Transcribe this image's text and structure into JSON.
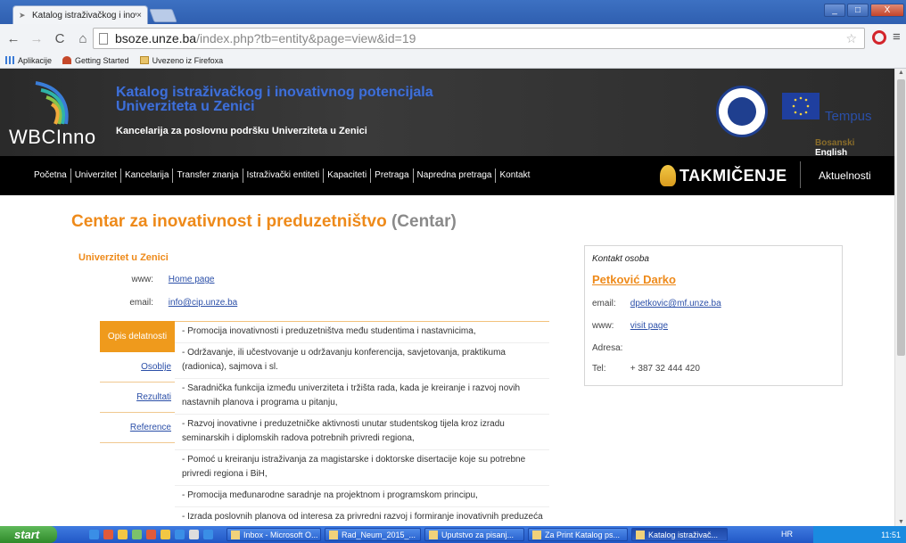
{
  "browser": {
    "tab_title": "Katalog istraživačkog i inova…",
    "tab_close": "×",
    "url_host": "bsoze.unze.ba",
    "url_path": "/index.php?tb=entity&page=view&id=19",
    "window_controls": [
      "_",
      "□",
      "X"
    ],
    "bookmarks": [
      {
        "label": "Aplikacije",
        "icon": "apps-icon"
      },
      {
        "label": "Getting Started",
        "icon": "getting-started-icon"
      },
      {
        "label": "Uvezeno iz Firefoxa",
        "icon": "folder-icon"
      }
    ]
  },
  "header": {
    "brand": "WBCInno",
    "title_line1": "Katalog istraživačkog i inovativnog potencijala",
    "title_line2": "Univerziteta u Zenici",
    "subtitle": "Kancelarija za poslovnu podršku Univerziteta u Zenici",
    "tempus": "Tempus",
    "lang_bs": "Bosanski",
    "lang_en": "English"
  },
  "nav": {
    "items": [
      "Početna",
      "Univerzitet",
      "Kancelarija",
      "Transfer znanja",
      "Istraživački entiteti",
      "Kapaciteti",
      "Pretraga",
      "Napredna pretraga",
      "Kontakt"
    ],
    "takmicenje": "TAKMIČENJE",
    "aktuelnosti": "Aktuelnosti"
  },
  "entity": {
    "name": "Centar za inovativnost i preduzetništvo",
    "abbr": "(Centar)",
    "university": "Univerzitet u Zenici",
    "www_label": "www:",
    "www_link": "Home page",
    "email_label": "email:",
    "email": "info@cip.unze.ba"
  },
  "tabs": [
    "Opis delatnosti",
    "Osoblje",
    "Rezultati",
    "Reference"
  ],
  "description": [
    "- Promocija inovativnosti i preduzetništva među studentima i nastavnicima,",
    "- Održavanje, ili učestvovanje u održavanju konferencija, savjetovanja, praktikuma (radionica), sajmova i sl.",
    "- Saradnička funkcija između univerziteta i tržišta rada, kada je kreiranje i razvoj novih nastavnih planova i programa u pitanju,",
    "- Razvoj inovativne i preduzetničke aktivnosti unutar studentskog tijela kroz izradu seminarskih i diplomskih radova potrebnih privredi regiona,",
    "- Pomoć u kreiranju istraživanja za magistarske i doktorske disertacije koje su potrebne privredi regiona i BiH,",
    "- Promocija međunarodne saradnje na projektnom i programskom principu,",
    "- Izrada poslovnih planova od interesa za privredni razvoj i formiranje inovativnih preduzeća kroz razvoj prototipova"
  ],
  "contact": {
    "heading": "Kontakt osoba",
    "name": "Petković Darko",
    "email_label": "email:",
    "email": "dpetkovic@mf.unze.ba",
    "www_label": "www:",
    "www_link": "visit page",
    "address_label": "Adresa:",
    "tel_label": "Tel:",
    "tel": "+ 387 32 444 420"
  },
  "taskbar": {
    "start": "start",
    "tasks": [
      "Inbox - Microsoft O...",
      "Rad_Neum_2015_...",
      "Uputstvo za pisanj...",
      "Za Print Katalog ps...",
      "Katalog istraživač..."
    ],
    "lang": "HR",
    "time": "11:51"
  }
}
